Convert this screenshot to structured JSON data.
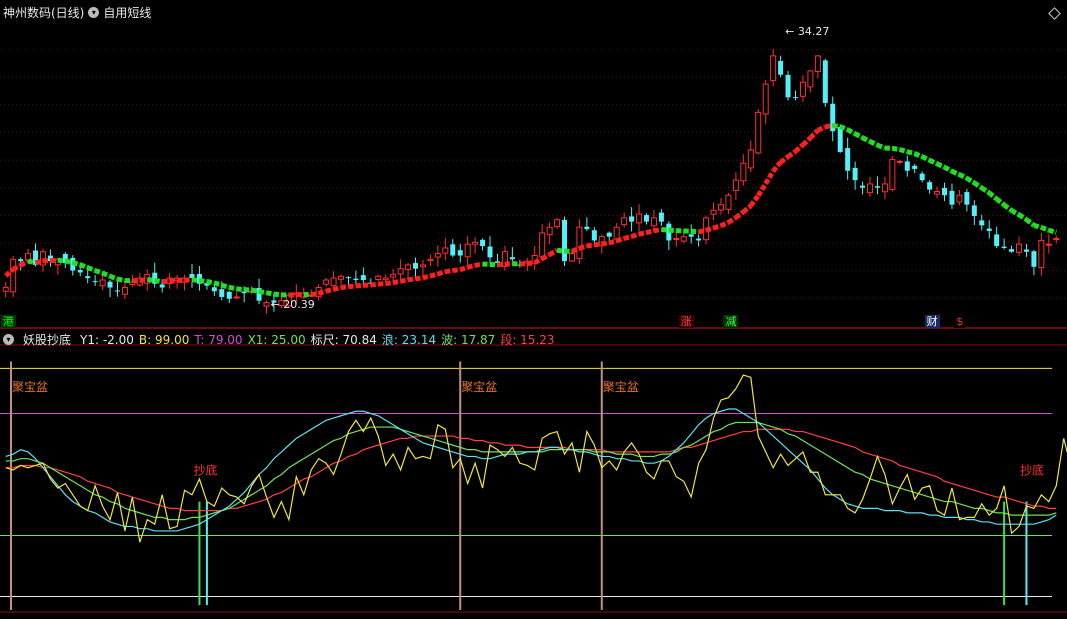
{
  "header": {
    "title": "神州数码(日线)",
    "indicator_name": "自用短线"
  },
  "sub_header": {
    "indicator_name": "妖股抄底",
    "params": [
      {
        "label": "Y1:",
        "value": "-2.00",
        "color": "#e8e8e8"
      },
      {
        "label": "B:",
        "value": "99.00",
        "color": "#f0e442"
      },
      {
        "label": "T:",
        "value": "79.00",
        "color": "#d050d0"
      },
      {
        "label": "X1:",
        "value": "25.00",
        "color": "#6ee35a"
      },
      {
        "label": "标尺:",
        "value": "70.84",
        "color": "#e8e8e8"
      },
      {
        "label": "浪:",
        "value": "23.14",
        "color": "#5ce1f0"
      },
      {
        "label": "波:",
        "value": "17.87",
        "color": "#6ee35a"
      },
      {
        "label": "段:",
        "value": "15.23",
        "color": "#ff4040"
      }
    ]
  },
  "price_labels": {
    "high": "34.27",
    "low": "20.39"
  },
  "markers": [
    {
      "text": "港",
      "color": "#00ff00",
      "bg": "#003300",
      "t": 0
    },
    {
      "text": "涨",
      "color": "#ff4040",
      "bg": "#330000",
      "t": 91
    },
    {
      "text": "减",
      "color": "#40ff40",
      "bg": "#003300",
      "t": 97
    },
    {
      "text": "财",
      "color": "#ffffff",
      "bg": "#1a2a66",
      "t": 124
    },
    {
      "text": "$",
      "color": "#ff3030",
      "bg": "#000000",
      "t": 128
    }
  ],
  "signal_labels": {
    "top": "聚宝盆",
    "bottom": "抄底"
  },
  "chart_data": [
    {
      "type": "candlestick",
      "title": "神州数码(日线)",
      "n": 142,
      "close": [
        21.1,
        22.6,
        22.5,
        22.9,
        22.3,
        23.0,
        22.5,
        22.6,
        22.4,
        22.0,
        21.9,
        21.6,
        21.4,
        21.5,
        21.1,
        20.9,
        21.1,
        21.4,
        21.6,
        21.8,
        21.3,
        21.1,
        21.6,
        21.6,
        21.6,
        21.6,
        21.3,
        21.2,
        20.9,
        20.6,
        20.5,
        20.6,
        20.8,
        20.9,
        20.4,
        20.3,
        20.3,
        20.4,
        20.7,
        20.8,
        20.8,
        20.7,
        21.1,
        21.5,
        21.6,
        21.7,
        21.6,
        21.5,
        21.5,
        21.3,
        21.7,
        21.6,
        21.8,
        22.1,
        22.3,
        22.1,
        22.3,
        22.6,
        22.9,
        23.2,
        22.8,
        22.8,
        23.4,
        23.5,
        23.3,
        22.7,
        22.4,
        23.0,
        22.6,
        22.3,
        22.5,
        22.8,
        24.0,
        24.3,
        24.7,
        22.5,
        22.9,
        24.3,
        24.2,
        23.6,
        23.8,
        23.8,
        24.3,
        24.8,
        24.6,
        25.0,
        24.6,
        24.8,
        24.6,
        23.6,
        23.7,
        23.8,
        23.8,
        23.6,
        24.8,
        25.2,
        25.5,
        26.0,
        26.8,
        27.7,
        28.4,
        30.4,
        31.9,
        33.4,
        32.4,
        31.2,
        31.2,
        32.0,
        32.6,
        33.4,
        30.9,
        29.4,
        28.3,
        27.3,
        26.8,
        26.4,
        26.6,
        26.4,
        26.6,
        27.9,
        27.8,
        27.3,
        27.4,
        26.8,
        26.3,
        26.2,
        26.0,
        25.5,
        26.0,
        25.5,
        24.9,
        24.4,
        24.1,
        23.3,
        23.2,
        23.0,
        23.4,
        23.0,
        22.2,
        23.6,
        23.4,
        23.7
      ],
      "ma": [
        21.72,
        22.07,
        22.28,
        22.51,
        22.41,
        22.52,
        22.52,
        22.55,
        22.51,
        22.42,
        22.31,
        22.16,
        22.0,
        21.87,
        21.7,
        21.55,
        21.47,
        21.46,
        21.47,
        21.52,
        21.48,
        21.41,
        21.44,
        21.47,
        21.49,
        21.51,
        21.47,
        21.42,
        21.34,
        21.22,
        21.11,
        21.03,
        20.99,
        20.97,
        20.89,
        20.82,
        20.75,
        20.71,
        20.7,
        20.72,
        20.73,
        20.72,
        20.79,
        20.91,
        21.0,
        21.1,
        21.15,
        21.18,
        21.22,
        21.23,
        21.28,
        21.31,
        21.36,
        21.43,
        21.51,
        21.56,
        21.62,
        21.71,
        21.82,
        21.94,
        22.0,
        22.05,
        22.17,
        22.28,
        22.34,
        22.33,
        22.3,
        22.35,
        22.36,
        22.35,
        22.37,
        22.42,
        22.63,
        22.85,
        23.08,
        23.03,
        23.02,
        23.18,
        23.31,
        23.36,
        23.42,
        23.47,
        23.58,
        23.71,
        23.81,
        23.93,
        24.02,
        24.11,
        24.18,
        24.15,
        24.12,
        24.1,
        24.09,
        24.05,
        24.14,
        24.26,
        24.38,
        24.56,
        24.81,
        25.11,
        25.44,
        25.98,
        26.61,
        27.28,
        27.75,
        28.05,
        28.33,
        28.68,
        29.04,
        29.45,
        29.64,
        29.7,
        29.65,
        29.48,
        29.27,
        29.05,
        28.86,
        28.66,
        28.51,
        28.49,
        28.43,
        28.31,
        28.21,
        28.05,
        27.86,
        27.67,
        27.49,
        27.27,
        27.1,
        26.9,
        26.66,
        26.39,
        26.13,
        25.8,
        25.49,
        25.19,
        24.97,
        24.71,
        24.4,
        24.29,
        24.14,
        24.03
      ],
      "y_range": [
        19.8,
        35.2
      ],
      "range_labels": [
        "34.27",
        "20.39"
      ]
    },
    {
      "type": "line",
      "title": "妖股抄底",
      "n": 142,
      "ylim": [
        -8,
        108
      ],
      "reference_lines": [
        {
          "name": "B",
          "value": 99.0,
          "color": "#f0e442"
        },
        {
          "name": "T",
          "value": 79.0,
          "color": "#d050d0"
        },
        {
          "name": "X1",
          "value": 25.0,
          "color": "#6ee35a"
        },
        {
          "name": "Y1",
          "value": -2.0,
          "color": "#e8e8e8"
        }
      ],
      "series": [
        {
          "name": "标尺",
          "color": "#f0e442",
          "values": [
            55,
            54,
            56,
            55,
            56,
            57,
            50,
            46,
            48,
            43,
            38,
            36,
            47,
            38,
            32,
            44,
            27,
            42,
            22,
            32,
            30,
            43,
            28,
            29,
            45,
            43,
            50,
            40,
            38,
            46,
            43,
            42,
            39,
            47,
            52,
            42,
            33,
            40,
            32,
            51,
            43,
            54,
            59,
            57,
            52,
            61,
            71,
            76,
            71,
            77,
            69,
            56,
            61,
            54,
            64,
            59,
            60,
            59,
            74,
            72,
            55,
            59,
            48,
            57,
            46,
            65,
            63,
            60,
            64,
            57,
            56,
            54,
            68,
            70,
            71,
            61,
            66,
            53,
            71,
            65,
            55,
            58,
            54,
            62,
            66,
            61,
            53,
            50,
            58,
            58,
            51,
            49,
            42,
            57,
            63,
            77,
            85,
            86,
            90,
            96,
            95,
            69,
            62,
            55,
            61,
            56,
            59,
            62,
            53,
            53,
            43,
            43,
            43,
            37,
            35,
            41,
            50,
            60,
            52,
            39,
            46,
            52,
            41,
            46,
            47,
            36,
            34,
            46,
            32,
            33,
            33,
            39,
            34,
            37,
            47,
            26,
            29,
            38,
            37,
            43,
            40,
            47,
            68,
            55,
            66,
            74
          ]
        },
        {
          "name": "浪",
          "color": "#5ce1f0",
          "values": [
            60,
            61,
            63,
            62,
            59,
            55,
            51,
            47,
            43,
            40,
            38,
            36,
            35,
            33,
            31,
            30,
            29,
            29,
            28,
            28,
            27,
            27,
            27,
            27,
            28,
            29,
            30,
            32,
            34,
            36,
            38,
            41,
            44,
            48,
            52,
            55,
            59,
            62,
            65,
            68,
            70,
            72,
            74,
            76,
            77,
            78,
            79,
            80,
            80,
            79,
            78,
            76,
            74,
            72,
            70,
            68,
            66,
            65,
            64,
            63,
            62,
            61,
            60,
            60,
            59,
            59,
            60,
            61,
            61,
            61,
            62,
            62,
            63,
            64,
            64,
            63,
            63,
            62,
            62,
            61,
            60,
            60,
            59,
            59,
            58,
            58,
            57,
            57,
            58,
            60,
            63,
            66,
            70,
            74,
            77,
            79,
            80,
            81,
            81,
            79,
            77,
            75,
            72,
            69,
            66,
            63,
            60,
            57,
            54,
            50,
            46,
            43,
            41,
            39,
            38,
            37,
            37,
            37,
            36,
            36,
            36,
            35,
            35,
            35,
            34,
            34,
            33,
            33,
            33,
            32,
            32,
            31,
            31,
            30,
            30,
            30,
            30,
            30,
            30,
            31,
            32,
            34
          ]
        },
        {
          "name": "波",
          "color": "#6ee35a",
          "values": [
            58,
            58,
            59,
            59,
            58,
            57,
            55,
            53,
            51,
            49,
            47,
            45,
            43,
            42,
            40,
            39,
            37,
            36,
            35,
            34,
            33,
            33,
            32,
            32,
            32,
            33,
            33,
            34,
            35,
            36,
            37,
            39,
            41,
            43,
            45,
            47,
            50,
            52,
            55,
            57,
            59,
            61,
            63,
            65,
            67,
            68,
            70,
            71,
            72,
            73,
            73,
            73,
            73,
            72,
            71,
            70,
            69,
            68,
            67,
            66,
            65,
            64,
            63,
            63,
            62,
            62,
            62,
            62,
            62,
            62,
            62,
            62,
            62,
            63,
            63,
            63,
            63,
            63,
            63,
            62,
            62,
            62,
            61,
            61,
            61,
            60,
            60,
            60,
            61,
            61,
            62,
            64,
            65,
            67,
            69,
            71,
            72,
            74,
            75,
            75,
            75,
            75,
            74,
            73,
            72,
            70,
            69,
            67,
            65,
            63,
            61,
            59,
            57,
            55,
            53,
            52,
            50,
            49,
            48,
            47,
            46,
            45,
            44,
            43,
            42,
            41,
            40,
            40,
            39,
            38,
            37,
            37,
            36,
            35,
            35,
            34,
            34,
            34,
            34,
            34,
            34,
            35
          ]
        },
        {
          "name": "段",
          "color": "#ff4040",
          "values": [
            55,
            55,
            56,
            56,
            56,
            55,
            55,
            54,
            53,
            52,
            51,
            49,
            48,
            47,
            46,
            44,
            43,
            42,
            41,
            40,
            39,
            38,
            37,
            37,
            36,
            36,
            36,
            36,
            36,
            36,
            37,
            37,
            38,
            39,
            40,
            41,
            43,
            44,
            46,
            48,
            50,
            51,
            53,
            55,
            57,
            58,
            60,
            61,
            63,
            64,
            65,
            66,
            67,
            68,
            68,
            69,
            69,
            69,
            69,
            69,
            69,
            68,
            68,
            67,
            67,
            66,
            66,
            65,
            65,
            65,
            64,
            64,
            64,
            64,
            64,
            64,
            63,
            63,
            63,
            63,
            63,
            62,
            62,
            62,
            62,
            62,
            62,
            62,
            62,
            62,
            63,
            64,
            64,
            65,
            66,
            67,
            68,
            69,
            70,
            71,
            71,
            72,
            72,
            72,
            72,
            72,
            71,
            71,
            70,
            69,
            68,
            67,
            66,
            65,
            64,
            62,
            61,
            60,
            59,
            58,
            56,
            55,
            54,
            53,
            52,
            51,
            49,
            48,
            47,
            46,
            45,
            44,
            43,
            42,
            42,
            41,
            40,
            39,
            38,
            38,
            37,
            37
          ]
        }
      ],
      "signals_top": [
        0,
        61,
        80
      ],
      "signals_bottom": [
        26,
        27,
        134,
        137
      ]
    }
  ]
}
